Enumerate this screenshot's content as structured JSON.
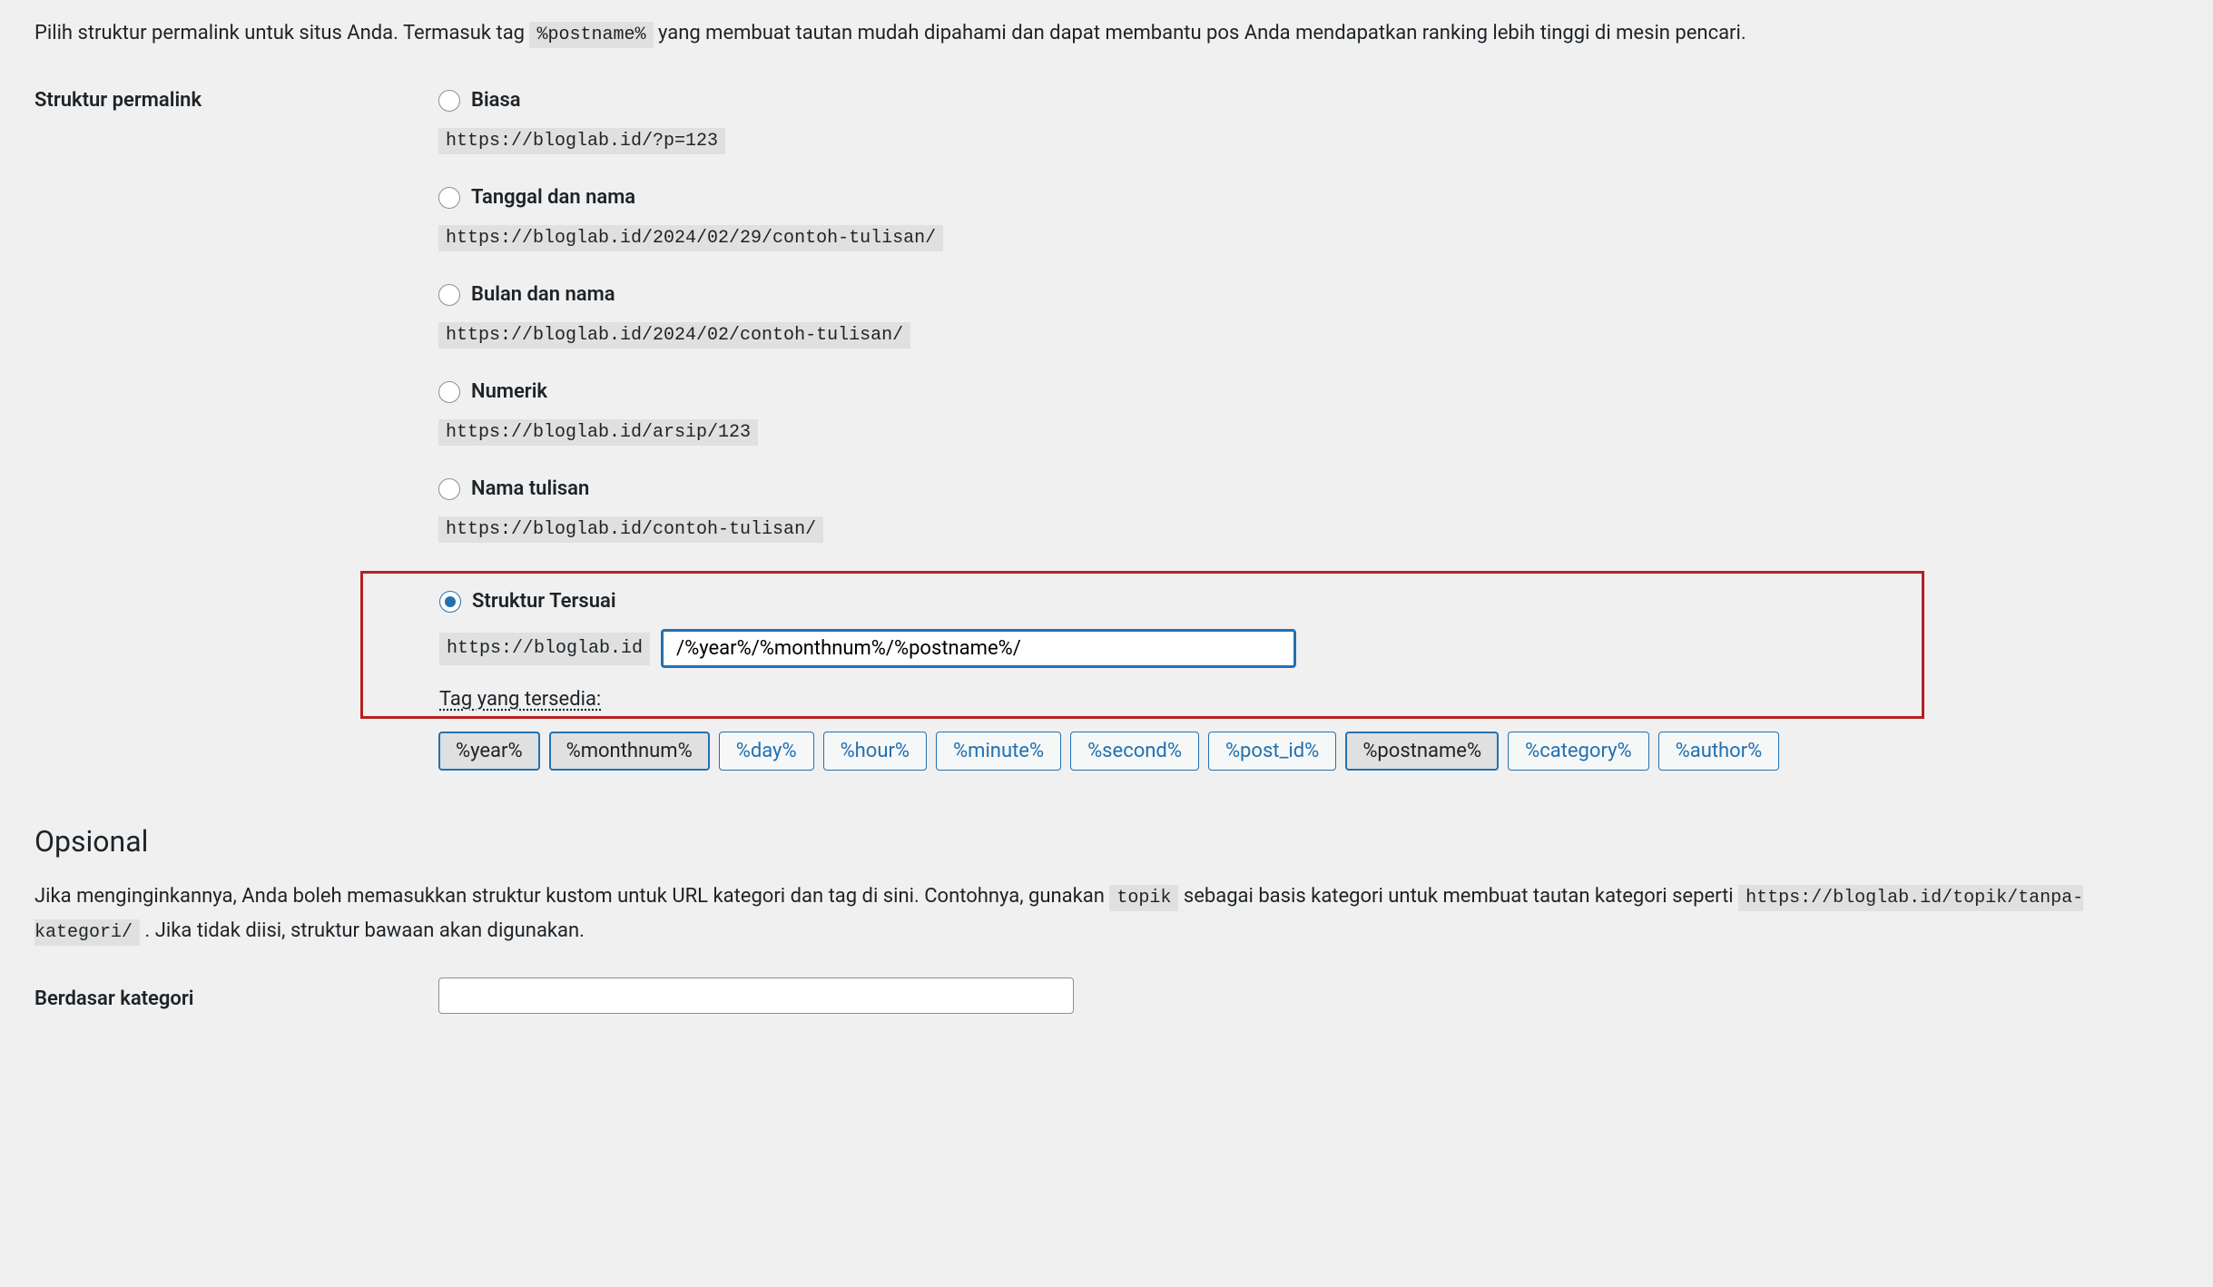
{
  "intro": {
    "before": "Pilih struktur permalink untuk situs Anda. Termasuk tag ",
    "code": "%postname%",
    "after": " yang membuat tautan mudah dipahami dan dapat membantu pos Anda mendapatkan ranking lebih tinggi di mesin pencari."
  },
  "section_label": "Struktur permalink",
  "options": [
    {
      "label": "Biasa",
      "example": "https://bloglab.id/?p=123"
    },
    {
      "label": "Tanggal dan nama",
      "example": "https://bloglab.id/2024/02/29/contoh-tulisan/"
    },
    {
      "label": "Bulan dan nama",
      "example": "https://bloglab.id/2024/02/contoh-tulisan/"
    },
    {
      "label": "Numerik",
      "example": "https://bloglab.id/arsip/123"
    },
    {
      "label": "Nama tulisan",
      "example": "https://bloglab.id/contoh-tulisan/"
    }
  ],
  "custom": {
    "label": "Struktur Tersuai",
    "prefix": "https://bloglab.id",
    "value": "/%year%/%monthnum%/%postname%/",
    "tags_label": "Tag yang tersedia:"
  },
  "tags": [
    "%year%",
    "%monthnum%",
    "%day%",
    "%hour%",
    "%minute%",
    "%second%",
    "%post_id%",
    "%postname%",
    "%category%",
    "%author%"
  ],
  "opsional": {
    "heading": "Opsional",
    "before": "Jika menginginkannya, Anda boleh memasukkan struktur kustom untuk URL kategori dan tag di sini. Contohnya, gunakan ",
    "code1": "topik",
    "mid": " sebagai basis kategori untuk membuat tautan kategori seperti ",
    "code2": "https://bloglab.id/topik/tanpa-kategori/",
    "after": " . Jika tidak diisi, struktur bawaan akan digunakan."
  },
  "category_base_label": "Berdasar kategori"
}
